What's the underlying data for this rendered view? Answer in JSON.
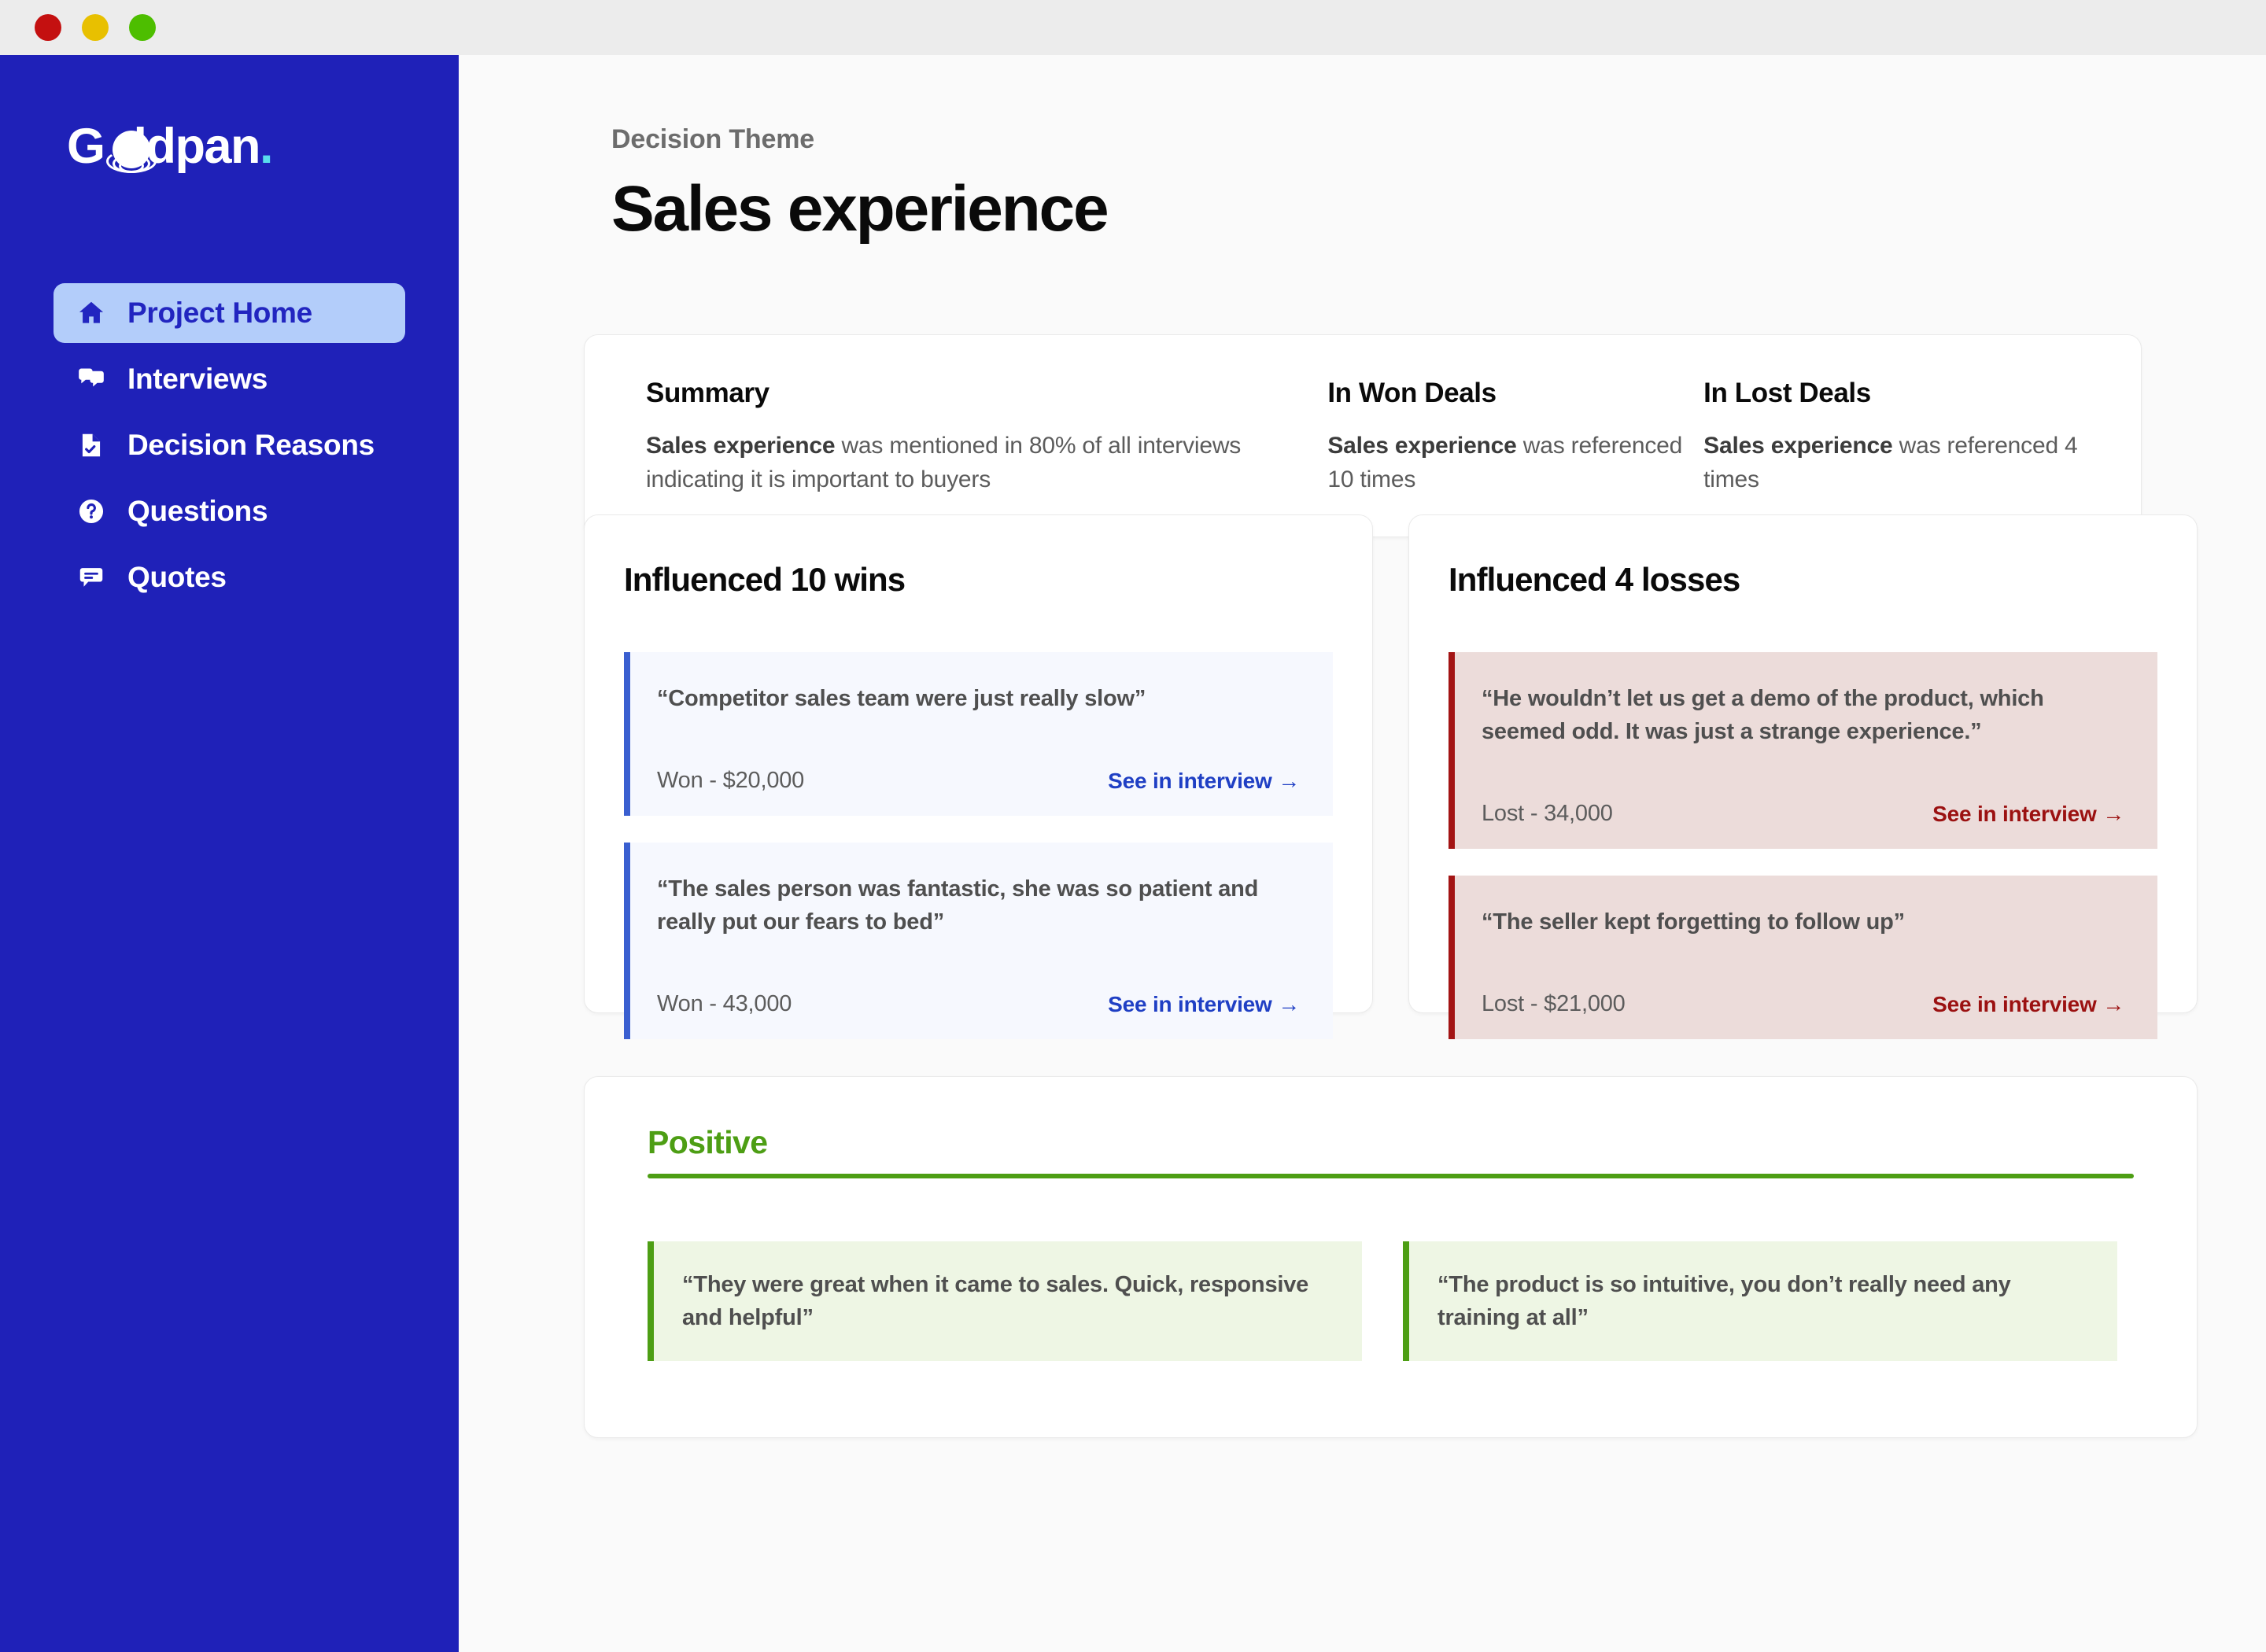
{
  "window": {
    "traffic_lights": [
      {
        "name": "close",
        "color": "#c41010"
      },
      {
        "name": "minimize",
        "color": "#e8c000"
      },
      {
        "name": "maximize",
        "color": "#4dbe00"
      }
    ]
  },
  "sidebar": {
    "brand": {
      "text_before": "G",
      "text_hole": "o",
      "text_after": "ldpan",
      "period": ".",
      "accent": "#59dced"
    },
    "background": "#1f21b8",
    "items": [
      {
        "label": "Project Home",
        "icon": "home-icon",
        "active": true
      },
      {
        "label": "Interviews",
        "icon": "speech-bubbles-icon",
        "active": false
      },
      {
        "label": "Decision Reasons",
        "icon": "document-check-icon",
        "active": false
      },
      {
        "label": "Questions",
        "icon": "question-circle-icon",
        "active": false
      },
      {
        "label": "Quotes",
        "icon": "quote-bubble-icon",
        "active": false
      }
    ]
  },
  "header": {
    "eyebrow": "Decision Theme",
    "title": "Sales experience"
  },
  "summary": {
    "main": {
      "title": "Summary",
      "bold": "Sales experience",
      "rest": " was mentioned in 80% of all interviews indicating it is important to buyers"
    },
    "won": {
      "title": "In Won Deals",
      "bold": "Sales experience",
      "rest": " was referenced 10 times"
    },
    "lost": {
      "title": "In Lost Deals",
      "bold": "Sales experience",
      "rest": " was referenced 4 times"
    }
  },
  "wins": {
    "title": "Influenced 10 wins",
    "accent": "#3a5fd0",
    "background": "#f6f8fe",
    "link_color": "#1f3fc4",
    "quotes": [
      {
        "text": "“Competitor sales team were just really slow”",
        "value": "Won - $20,000",
        "link": "See in interview →"
      },
      {
        "text": "“The sales person was fantastic, she was so patient and really put our fears to bed”",
        "value": "Won - 43,000",
        "link": "See in interview →"
      }
    ]
  },
  "losses": {
    "title": "Influenced 4 losses",
    "accent": "#a31414",
    "background": "#ecdcda",
    "link_color": "#9b1111",
    "quotes": [
      {
        "text": "“He wouldn’t let us get a demo of the product, which seemed odd. It was just a strange experience.”",
        "value": "Lost - 34,000",
        "link": "See in interview →"
      },
      {
        "text": "“The seller kept forgetting to follow up”",
        "value": "Lost - $21,000",
        "link": "See in interview →"
      }
    ]
  },
  "sentiment": {
    "title": "Positive",
    "accent": "#4d9e14",
    "background": "#eef6e4",
    "quotes": [
      {
        "text": "“They were great when it came to sales. Quick, responsive and helpful”"
      },
      {
        "text": "“The product is so intuitive, you don’t really need any training at all”"
      }
    ]
  }
}
